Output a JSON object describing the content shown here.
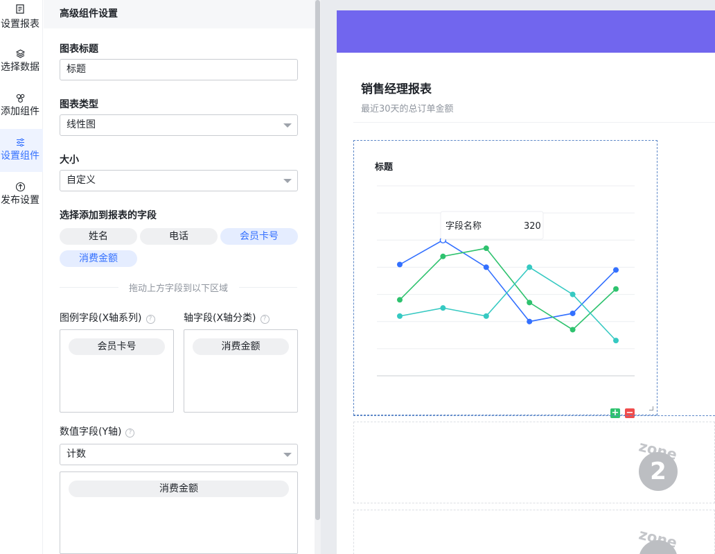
{
  "rail": [
    {
      "label": "设置报表",
      "icon": "document-icon"
    },
    {
      "label": "选择数据",
      "icon": "layers-icon"
    },
    {
      "label": "添加组件",
      "icon": "components-icon"
    },
    {
      "label": "设置组件",
      "icon": "sliders-icon",
      "active": true
    },
    {
      "label": "发布设置",
      "icon": "upload-icon"
    }
  ],
  "panel": {
    "title": "高级组件设置",
    "chart_title_label": "图表标题",
    "chart_title_value": "标题",
    "chart_type_label": "图表类型",
    "chart_type_value": "线性图",
    "size_label": "大小",
    "size_value": "自定义",
    "fields_label": "选择添加到报表的字段",
    "fields": [
      {
        "name": "姓名",
        "selected": false
      },
      {
        "name": "电话",
        "selected": false
      },
      {
        "name": "会员卡号",
        "selected": true
      },
      {
        "name": "消费金额",
        "selected": true
      }
    ],
    "drag_hint": "拖动上方字段到以下区域",
    "legend_field_label": "图例字段(X轴系列)",
    "legend_field_chip": "会员卡号",
    "axis_field_label": "轴字段(X轴分类)",
    "axis_field_chip": "消费金额",
    "value_field_label": "数值字段(Y轴)",
    "value_agg_value": "计数",
    "value_field_chip": "消费金额",
    "help_mark": "?"
  },
  "report": {
    "banner_color": "#7166ee",
    "title": "销售经理报表",
    "subtitle": "最近30天的总订单金额"
  },
  "widget": {
    "add_symbol": "+",
    "remove_symbol": "−",
    "watermark_text": "zone",
    "watermark_number_2": "2"
  },
  "chart_data": {
    "type": "line",
    "title": "标题",
    "x": [
      1,
      2,
      3,
      4,
      5,
      6
    ],
    "ylim": [
      0,
      7
    ],
    "grid": true,
    "series": [
      {
        "color": "#3370ff",
        "values": [
          4.1,
          5.0,
          4.0,
          2.0,
          2.3,
          3.9
        ]
      },
      {
        "color": "#2ec26e",
        "values": [
          2.8,
          4.4,
          4.7,
          2.7,
          1.7,
          3.2
        ]
      },
      {
        "color": "#36c9c2",
        "values": [
          2.2,
          2.5,
          2.2,
          4.0,
          3.0,
          1.3
        ]
      }
    ],
    "tooltip": {
      "label": "字段名称",
      "value": "320"
    }
  }
}
